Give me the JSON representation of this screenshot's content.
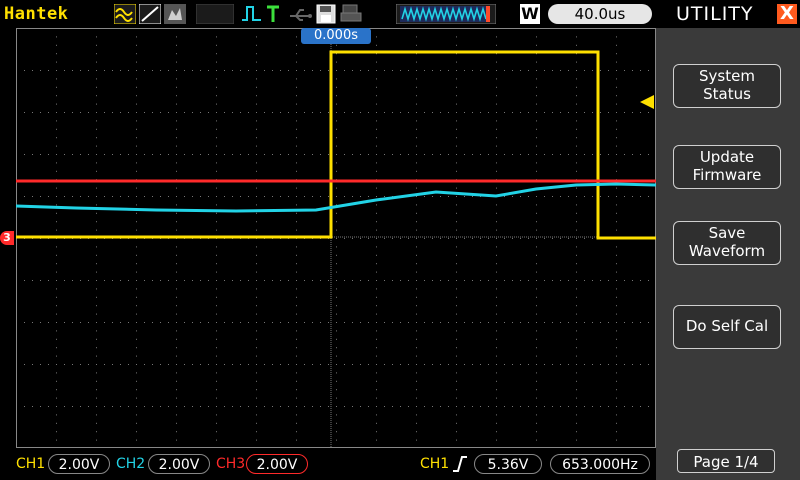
{
  "app": {
    "brand": "Hantek"
  },
  "toolbar": {
    "icons": [
      "waveform-icon",
      "ramp-icon",
      "persistence-icon",
      "trigger-pulse-icon",
      "trigger-T-icon",
      "usb-icon",
      "save-icon",
      "print-icon"
    ],
    "window_indicator": "W",
    "timebase": "40.0us"
  },
  "screen": {
    "trigger_position": "0.000s",
    "ch3_marker": "3"
  },
  "panel": {
    "title": "UTILITY",
    "close_label": "X",
    "buttons": [
      {
        "lines": [
          "System",
          "Status"
        ]
      },
      {
        "lines": [
          "Update",
          "Firmware"
        ]
      },
      {
        "lines": [
          "Save",
          "Waveform"
        ]
      },
      {
        "lines": [
          "Do Self Cal"
        ]
      }
    ],
    "page": "Page 1/4"
  },
  "status": {
    "ch1_label": "CH1",
    "ch1_scale": "2.00V",
    "ch2_label": "CH2",
    "ch2_scale": "2.00V",
    "ch3_label": "CH3",
    "ch3_scale": "2.00V",
    "trig_source": "CH1",
    "trig_level": "5.36V",
    "frequency": "653.000Hz"
  },
  "colors": {
    "ch1": "#ffe000",
    "ch2": "#22d3e6",
    "ch3": "#ff2a2a",
    "accent": "#2a73c9"
  }
}
